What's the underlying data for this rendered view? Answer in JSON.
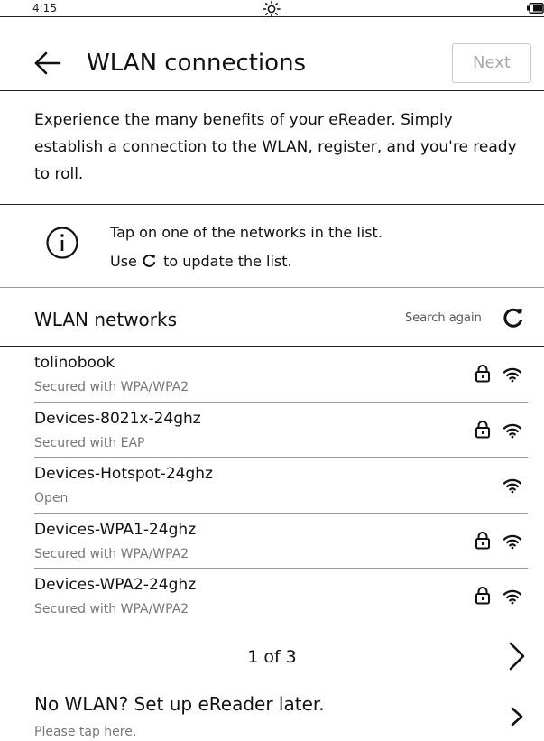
{
  "status_bar": {
    "time": "4:15",
    "center_icon": "sun-icon",
    "right_icon": "battery-icon"
  },
  "header": {
    "back_icon": "arrow-left-icon",
    "title": "WLAN connections",
    "next_label": "Next"
  },
  "intro": {
    "text": "Experience the many benefits of your eReader. Simply establish a connection to the WLAN, register, and you're ready to roll."
  },
  "info": {
    "icon": "info-icon",
    "line1": "Tap on one of the networks in the list.",
    "line2_prefix": "Use",
    "line2_icon": "refresh-icon",
    "line2_suffix": "to update the list."
  },
  "networks_section": {
    "title": "WLAN networks",
    "search_again": "Search again",
    "refresh_icon": "refresh-icon"
  },
  "networks": [
    {
      "name": "tolinobook",
      "security": "Secured with WPA/WPA2",
      "locked": true
    },
    {
      "name": "Devices-8021x-24ghz",
      "security": "Secured with EAP",
      "locked": true
    },
    {
      "name": "Devices-Hotspot-24ghz",
      "security": "Open",
      "locked": false
    },
    {
      "name": "Devices-WPA1-24ghz",
      "security": "Secured with WPA/WPA2",
      "locked": true
    },
    {
      "name": "Devices-WPA2-24ghz",
      "security": "Secured with WPA/WPA2",
      "locked": true
    }
  ],
  "pagination": {
    "label": "1 of 3",
    "next_icon": "chevron-right-icon"
  },
  "later": {
    "title": "No WLAN? Set up eReader later.",
    "subtitle": "Please tap here.",
    "icon": "chevron-right-icon"
  }
}
